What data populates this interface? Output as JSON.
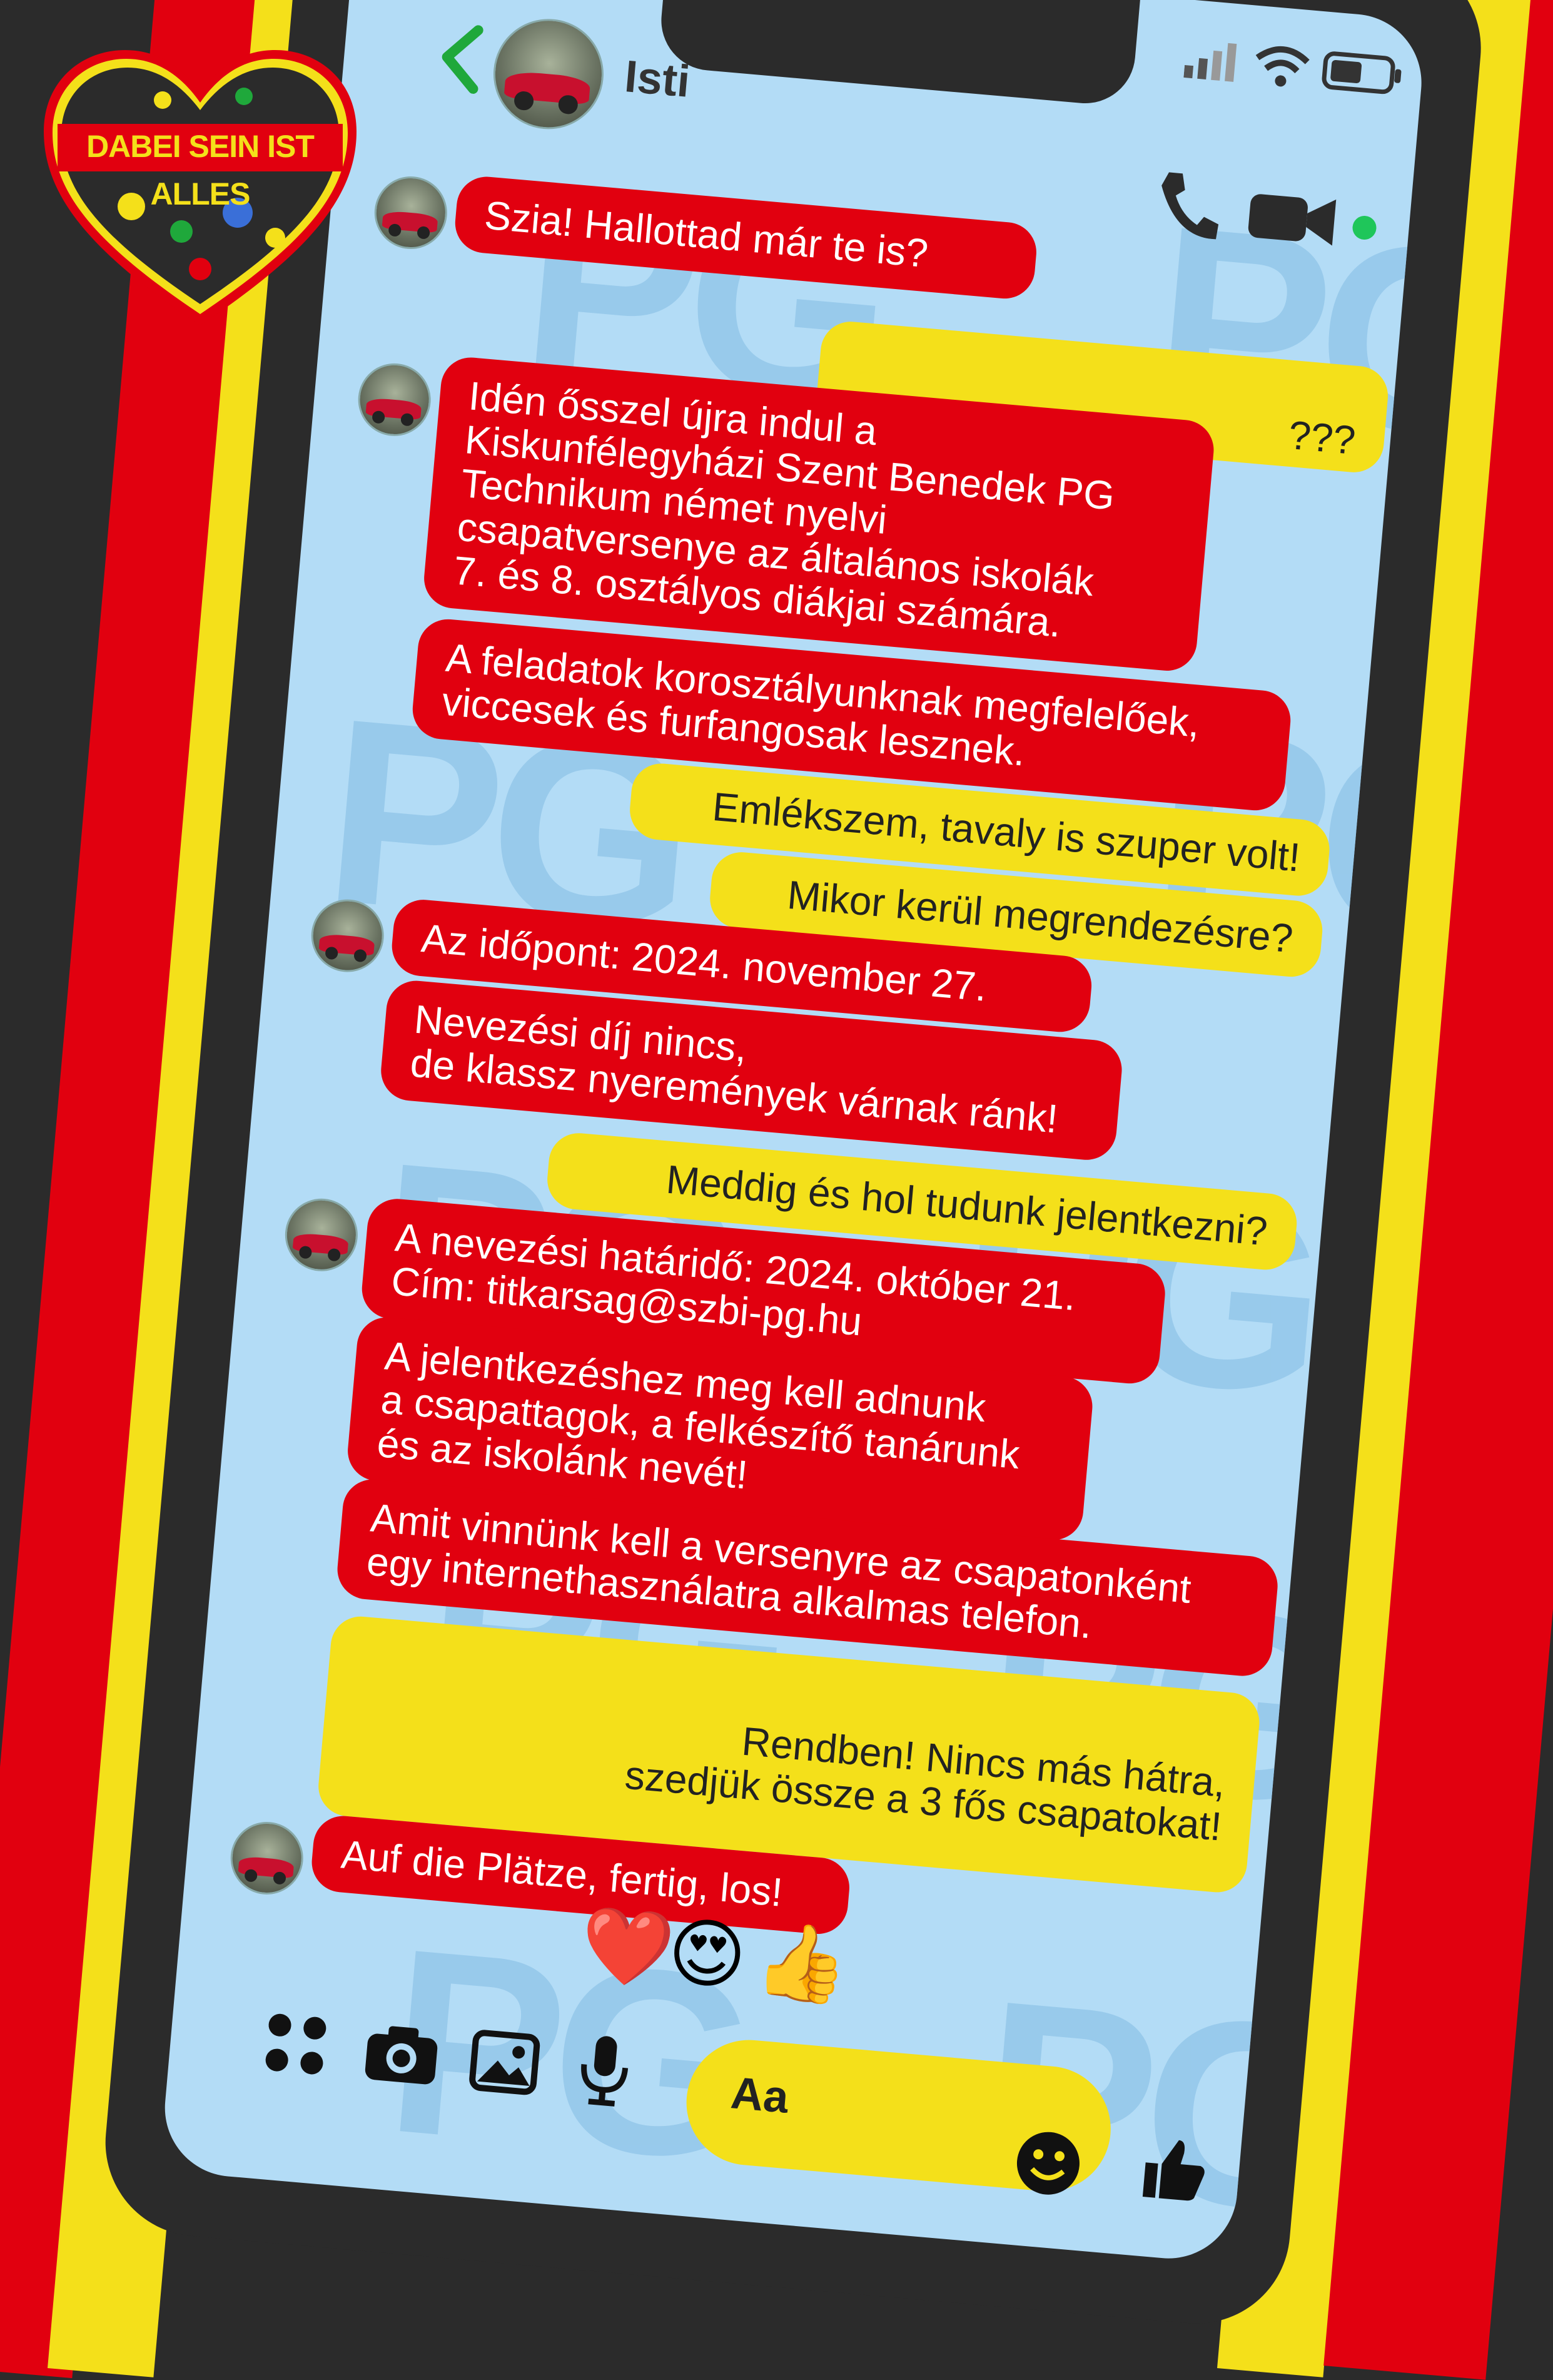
{
  "header": {
    "contact_name": "Isti"
  },
  "badge": {
    "text": "DABEI SEIN IST ALLES"
  },
  "watermark": {
    "text": "PG"
  },
  "messages": [
    {
      "from": "other",
      "text": "Szia! Hallottad már te is?"
    },
    {
      "from": "me",
      "text": "???"
    },
    {
      "from": "other",
      "text": "Idén ősszel újra indul a\nKiskunfélegyházi Szent Benedek PG\nTechnikum német nyelvi\ncsapatversenye az általános iskolák\n7. és 8. osztályos diákjai számára."
    },
    {
      "from": "other",
      "text": "A feladatok korosztályunknak megfelelőek,\nviccesek és furfangosak lesznek."
    },
    {
      "from": "me",
      "text": "Emlékszem, tavaly is szuper volt!"
    },
    {
      "from": "me",
      "text": "Mikor kerül megrendezésre?"
    },
    {
      "from": "other",
      "text": "Az időpont: 2024. november 27."
    },
    {
      "from": "other",
      "text": "Nevezési díj nincs,\nde klassz nyeremények várnak ránk!"
    },
    {
      "from": "me",
      "text": "Meddig és hol tudunk jelentkezni?"
    },
    {
      "from": "other",
      "text": "A nevezési határidő: 2024. október 21.\nCím: titkarsag@szbi-pg.hu"
    },
    {
      "from": "other",
      "text": "A jelentkezéshez meg kell adnunk\na csapattagok, a felkészítő tanárunk\nés az iskolánk nevét!"
    },
    {
      "from": "other",
      "text": "Amit vinnünk kell a versenyre az csapatonként\negy internethasználatra alkalmas telefon."
    },
    {
      "from": "me",
      "text": "Rendben! Nincs más hátra,\nszedjük össze a 3 fős csapatokat!"
    },
    {
      "from": "other",
      "text": "Auf die Plätze, fertig, los!"
    }
  ],
  "reactions": [
    "❤️",
    "😍",
    "👍"
  ],
  "composer": {
    "placeholder": "Aa"
  },
  "colors": {
    "red": "#e1000f",
    "yellow": "#f4e01a",
    "black": "#2b2b2b",
    "screen": "#b3dcf6",
    "online": "#1fc65a",
    "back": "#1fa83b"
  }
}
